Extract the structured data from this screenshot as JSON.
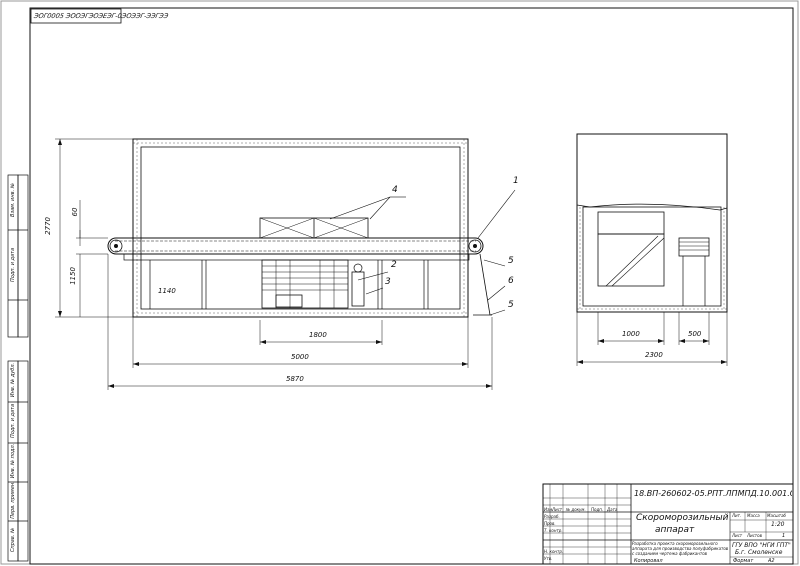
{
  "stamp_top": "ЭОГ0005 ЭООЭГЭОЭЕЭГ-0ЭОЭЭГ-ЭЭГЭЭ",
  "dimensions": {
    "height_total": "2770",
    "height_upper": "60",
    "height_conveyor": "1150",
    "height_lower": "1140",
    "width_inner": "1800",
    "width_chamber": "5000",
    "width_total": "5870",
    "side_width_a": "1000",
    "side_width_b": "500",
    "side_width_total": "2300"
  },
  "positions": [
    "1",
    "2",
    "3",
    "4",
    "5",
    "6",
    "5"
  ],
  "side_labels": [
    "Взам. инв. №",
    "Подп. и дата",
    "Инв. № дубл.",
    "Подп. и дата",
    "Инв. № подл.",
    "Перв. примен.",
    "Справ. №"
  ],
  "title_block": {
    "doc_code": "18.ВП-260602-05.РПТ.ЛПМПД.10.001.СБ",
    "title_line1": "Скороморозильный",
    "title_line2": "аппарат",
    "org_line1": "ГГУ ВПО \"НГИ ГПТ\"",
    "org_line2": "Б.г. Смоленске",
    "scale": "1:20",
    "sheet_label": "Лист",
    "sheets_label": "Листов",
    "sheets": "1",
    "mass_label": "Масса",
    "scale_label": "Масштаб",
    "lit_label": "Лит.",
    "format": "A2",
    "format_label": "Формат",
    "copy_label": "Копировал",
    "desc": "Разработка проекта скороморозильного аппарата для производства полуфабрикатов с созданием чертежа фабрикантов",
    "rows": [
      "Изм.",
      "Лист",
      "№ докум.",
      "Подп.",
      "Дата"
    ],
    "people": [
      "Разраб.",
      "Пров.",
      "Т. контр.",
      "Н. контр.",
      "Утв."
    ]
  }
}
